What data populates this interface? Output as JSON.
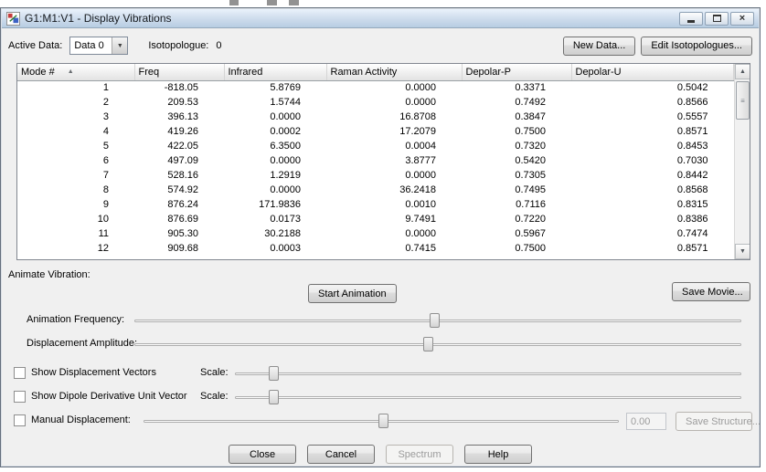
{
  "window": {
    "title": "G1:M1:V1 - Display Vibrations"
  },
  "icons": {
    "close": "×",
    "dropdown_arrow": "▼",
    "scroll_up": "▲",
    "scroll_down": "▼",
    "sort_ascending": "▲",
    "thumb_grip": "≡"
  },
  "toolbar": {
    "active_data_label": "Active Data:",
    "active_data_value": "Data 0",
    "isotopologue_label": "Isotopologue:",
    "isotopologue_value": "0",
    "new_data_button": "New Data...",
    "edit_isotopologues_button": "Edit Isotopologues..."
  },
  "table": {
    "columns": [
      "Mode #",
      "Freq",
      "Infrared",
      "Raman Activity",
      "Depolar-P",
      "Depolar-U"
    ],
    "rows": [
      [
        "1",
        "-818.05",
        "5.8769",
        "0.0000",
        "0.3371",
        "0.5042"
      ],
      [
        "2",
        "209.53",
        "1.5744",
        "0.0000",
        "0.7492",
        "0.8566"
      ],
      [
        "3",
        "396.13",
        "0.0000",
        "16.8708",
        "0.3847",
        "0.5557"
      ],
      [
        "4",
        "419.26",
        "0.0002",
        "17.2079",
        "0.7500",
        "0.8571"
      ],
      [
        "5",
        "422.05",
        "6.3500",
        "0.0004",
        "0.7320",
        "0.8453"
      ],
      [
        "6",
        "497.09",
        "0.0000",
        "3.8777",
        "0.5420",
        "0.7030"
      ],
      [
        "7",
        "528.16",
        "1.2919",
        "0.0000",
        "0.7305",
        "0.8442"
      ],
      [
        "8",
        "574.92",
        "0.0000",
        "36.2418",
        "0.7495",
        "0.8568"
      ],
      [
        "9",
        "876.24",
        "171.9836",
        "0.0010",
        "0.7116",
        "0.8315"
      ],
      [
        "10",
        "876.69",
        "0.0173",
        "9.7491",
        "0.7220",
        "0.8386"
      ],
      [
        "11",
        "905.30",
        "30.2188",
        "0.0000",
        "0.5967",
        "0.7474"
      ],
      [
        "12",
        "909.68",
        "0.0003",
        "0.7415",
        "0.7500",
        "0.8571"
      ]
    ]
  },
  "animation": {
    "section_label": "Animate Vibration:",
    "start_button": "Start Animation",
    "save_movie_button": "Save Movie...",
    "frequency_label": "Animation Frequency:",
    "amplitude_label": "Displacement Amplitude:"
  },
  "sliders": {
    "frequency_pct": 49.5,
    "amplitude_pct": 48.5,
    "vectors_scale_pct": 7.7,
    "dipole_scale_pct": 7.7,
    "manual_pct": 50.5
  },
  "options": {
    "show_vectors_label": "Show Displacement Vectors",
    "show_dipole_label": "Show Dipole Derivative Unit Vector",
    "manual_label": "Manual Displacement:",
    "scale_label": "Scale:",
    "manual_value": "0.00",
    "save_structure_button": "Save Structure..."
  },
  "footer": {
    "close_button": "Close",
    "cancel_button": "Cancel",
    "spectrum_button": "Spectrum",
    "help_button": "Help"
  }
}
